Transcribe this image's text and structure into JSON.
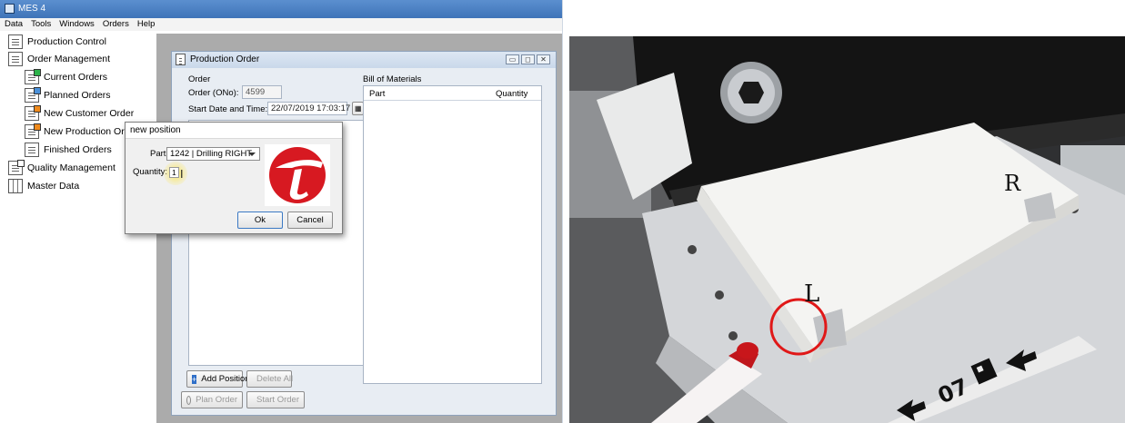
{
  "app": {
    "title": "MES 4",
    "menu": [
      "Data",
      "Tools",
      "Windows",
      "Orders",
      "Help"
    ],
    "tree": [
      {
        "label": "Production Control",
        "icon": "document-icon"
      },
      {
        "label": "Order Management",
        "icon": "document-icon"
      },
      {
        "label": "Current Orders",
        "icon": "current-orders-icon"
      },
      {
        "label": "Planned Orders",
        "icon": "planned-orders-icon"
      },
      {
        "label": "New Customer Order",
        "icon": "new-customer-order-icon"
      },
      {
        "label": "New Production Order",
        "icon": "new-production-order-icon"
      },
      {
        "label": "Finished Orders",
        "icon": "document-icon"
      },
      {
        "label": "Quality Management",
        "icon": "quality-icon"
      },
      {
        "label": "Master Data",
        "icon": "grid-icon"
      }
    ]
  },
  "production_order": {
    "title": "Production Order",
    "order_section": "Order",
    "order_no_label": "Order (ONo):",
    "order_no_value": "4599",
    "start_label": "Start Date and Time:",
    "start_value": "22/07/2019 17:03:17",
    "bom_title": "Bill of Materials",
    "bom_columns": [
      "Part",
      "Quantity"
    ],
    "add_position": "Add Position",
    "delete_all": "Delete All",
    "plan_order": "Plan Order",
    "start_order": "Start Order"
  },
  "dialog": {
    "title": "new position",
    "part_label": "Part:",
    "part_value": "1242 | Drilling RIGHT",
    "quantity_label": "Quantity:",
    "quantity_value": "1",
    "ok": "Ok",
    "cancel": "Cancel",
    "logo": "red-circle-logo"
  },
  "photo": {
    "label_r": "R",
    "label_l": "L",
    "tag_number": "07",
    "highlight_color": "#e01818"
  }
}
